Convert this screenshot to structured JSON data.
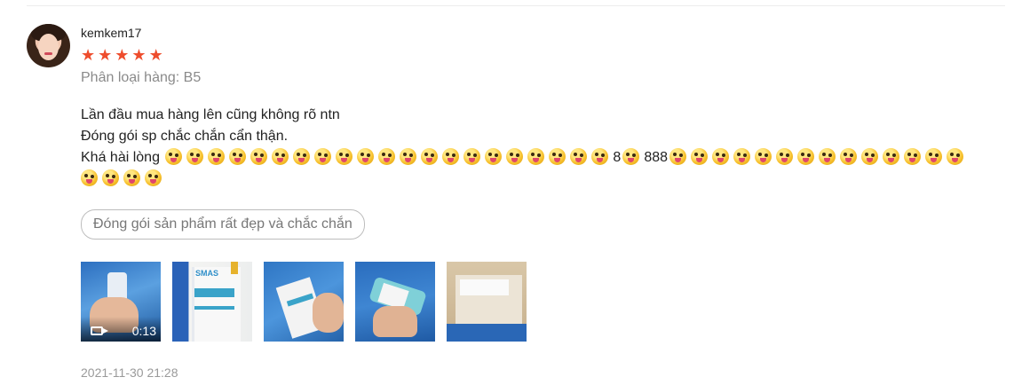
{
  "review": {
    "username": "kemkem17",
    "rating": 5,
    "rating_max": 5,
    "star_icon": "★",
    "colors": {
      "star": "#ee4d2d",
      "meta": "#8a8a8a"
    },
    "variation": "Phân loại hàng: B5",
    "comment": {
      "line1": "Lần đầu mua hàng lên cũng không rõ ntn",
      "line2": "Đóng gói sp chắc chắn cẩn thận.",
      "line3_prefix": "Khá hài lòng",
      "emoji_icon": "zany-face-emoji",
      "inline_1": "8",
      "inline_2": "888"
    },
    "tag": "Đóng gói sản phẩm rất đẹp và chắc chắn",
    "media": [
      {
        "type": "video",
        "duration": "0:13",
        "icon": "video-camera-icon"
      },
      {
        "type": "image",
        "brand_text": "SMAS"
      },
      {
        "type": "image"
      },
      {
        "type": "image"
      },
      {
        "type": "image"
      }
    ],
    "timestamp": "2021-11-30 21:28"
  }
}
